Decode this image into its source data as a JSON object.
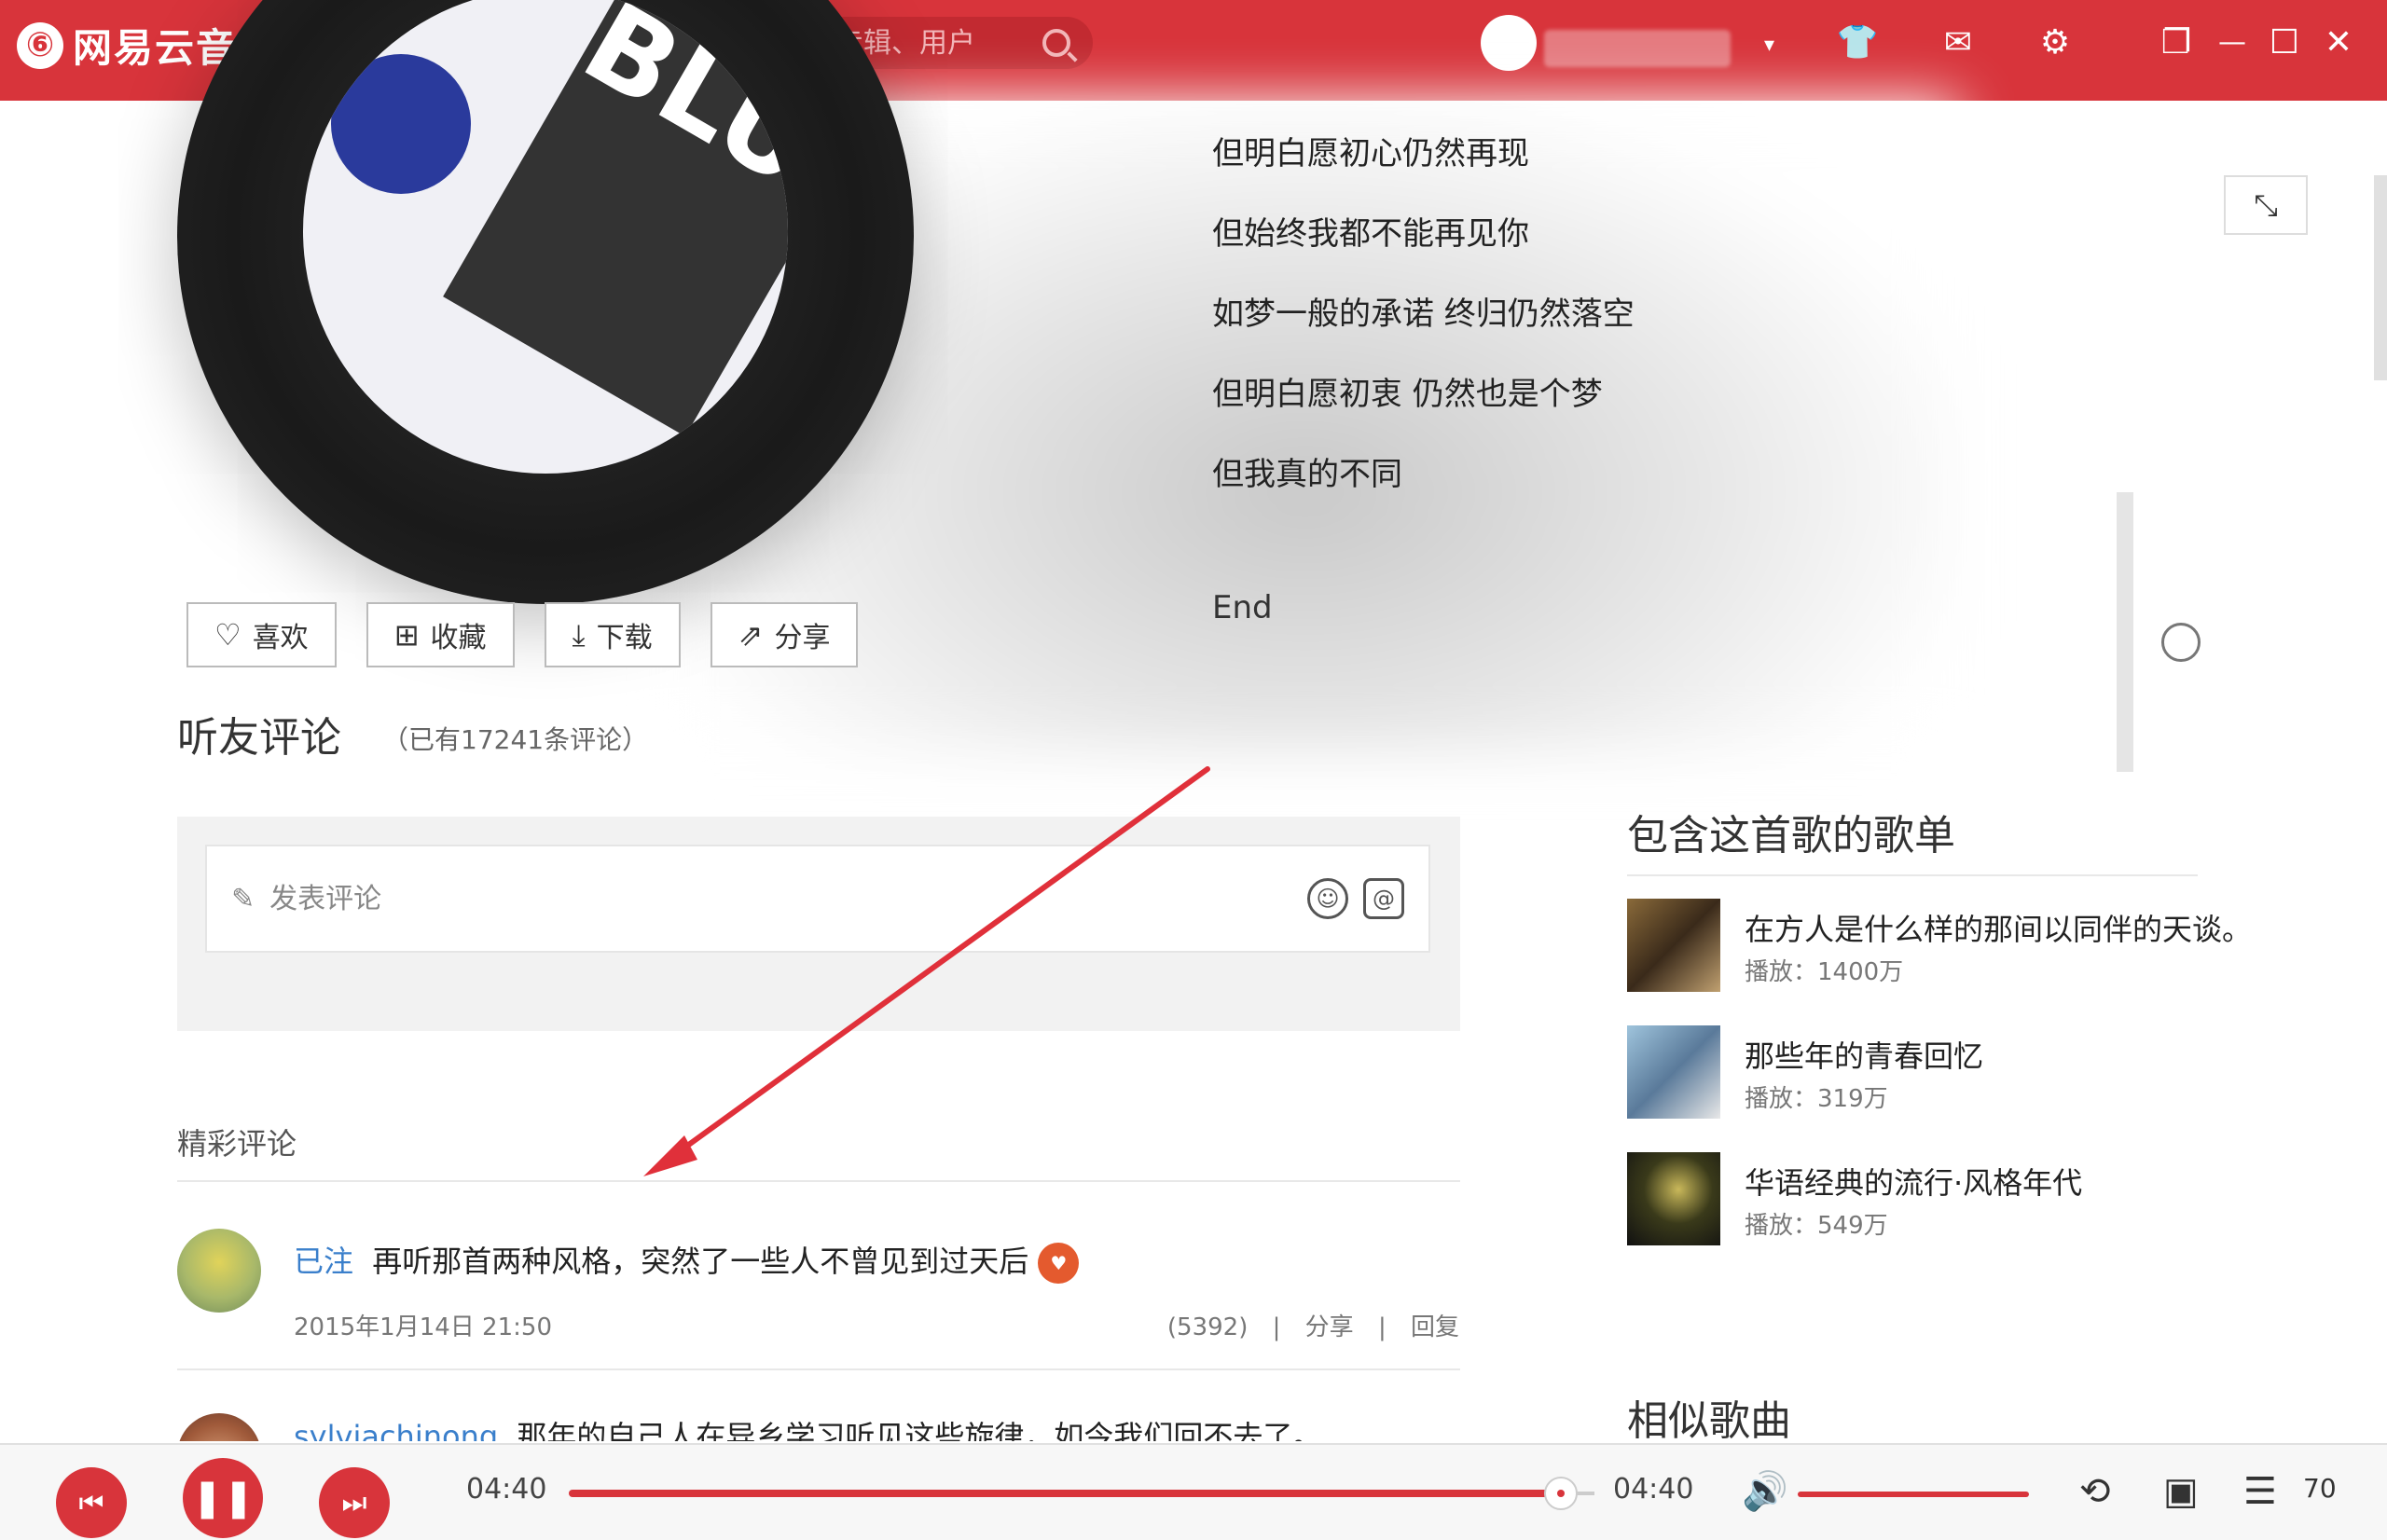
{
  "app": {
    "logo_glyph": "⑥",
    "title": "网易云音乐"
  },
  "search": {
    "placeholder": "搜索歌曲、歌手、专辑、用户"
  },
  "album": {
    "cover_text": "BLUE"
  },
  "lyrics": {
    "lines": [
      "但明白愿初心仍然再现",
      "但始终我都不能再见你",
      "如梦一般的承诺 终归仍然落空",
      "但明白愿初衷 仍然也是个梦",
      "但我真的不同"
    ],
    "end": "End"
  },
  "actions": {
    "like": "喜欢",
    "collect": "收藏",
    "download": "下载",
    "share": "分享"
  },
  "comments": {
    "title": "听友评论",
    "count": "（已有17241条评论）",
    "input_placeholder": "发表评论",
    "section_label": "精彩评论",
    "items": [
      {
        "user": "已注",
        "text": "再听那首两种风格，突然了一些人不曾见到过天后",
        "date": "2015年1月14日 21:50",
        "likes": "(5392)",
        "share": "分享",
        "reply": "回复"
      },
      {
        "user": "sylviachinong",
        "text": "那年的自己人在异乡学习听见这些旋律，如今我们回不去了。"
      }
    ]
  },
  "playlists": {
    "title": "包含这首歌的歌单",
    "items": [
      {
        "name": "在方人是什么样的那间以同伴的天谈。",
        "plays": "播放：1400万"
      },
      {
        "name": "那些年的青春回忆",
        "plays": "播放：319万"
      },
      {
        "name": "华语经典的流行·风格年代",
        "plays": "播放：549万"
      }
    ]
  },
  "similar": {
    "title": "相似歌曲"
  },
  "player": {
    "current_time": "04:40",
    "total_time": "04:40",
    "progress": 1.0,
    "volume": 1.0,
    "queue_count": "70"
  }
}
